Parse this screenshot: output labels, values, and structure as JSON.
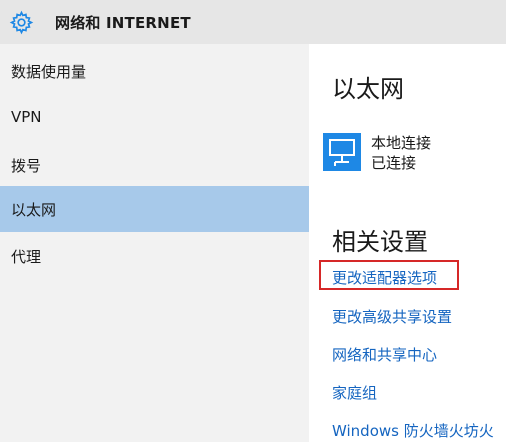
{
  "header": {
    "title": "网络和 INTERNET",
    "icon": "gear-icon"
  },
  "sidebar": {
    "items": [
      {
        "label": "数据使用量",
        "active": false
      },
      {
        "label": "VPN",
        "active": false
      },
      {
        "label": "拨号",
        "active": false
      },
      {
        "label": "以太网",
        "active": true
      },
      {
        "label": "代理",
        "active": false
      }
    ],
    "active_color": "#a7c9ea"
  },
  "main": {
    "heading": "以太网",
    "connection": {
      "icon": "network-monitor-icon",
      "name": "本地连接",
      "status": "已连接"
    },
    "related_heading": "相关设置",
    "links": [
      "更改适配器选项",
      "更改高级共享设置",
      "网络和共享中心",
      "家庭组",
      "Windows 防火墙火坊火"
    ],
    "highlight_color": "#d62828",
    "link_color": "#1565c0"
  }
}
